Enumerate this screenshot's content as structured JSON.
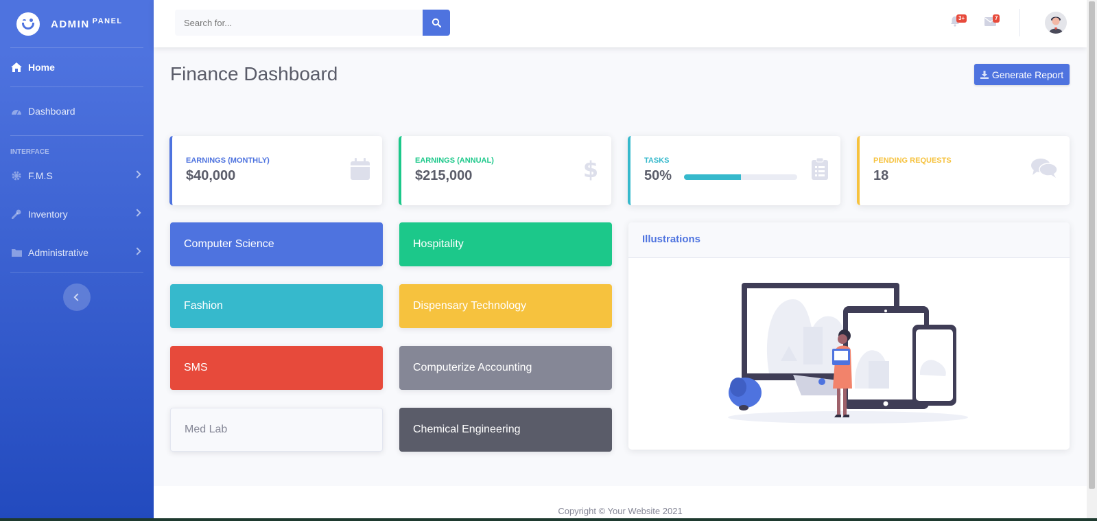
{
  "brand": {
    "name": "ADMIN",
    "suffix": "PANEL"
  },
  "sidebar": {
    "home": "Home",
    "dashboard": "Dashboard",
    "heading": "INTERFACE",
    "items": [
      {
        "label": "F.M.S",
        "icon": "cog-icon"
      },
      {
        "label": "Inventory",
        "icon": "wrench-icon"
      },
      {
        "label": "Administrative",
        "icon": "folder-icon"
      }
    ]
  },
  "topbar": {
    "search_placeholder": "Search for...",
    "alerts_badge": "3+",
    "messages_badge": "7"
  },
  "page": {
    "title": "Finance Dashboard",
    "generate_report": "Generate Report"
  },
  "stats": [
    {
      "label": "Earnings (Monthly)",
      "value": "$40,000",
      "color": "#4e73df",
      "icon": "calendar-icon"
    },
    {
      "label": "Earnings (Annual)",
      "value": "$215,000",
      "color": "#1cc88a",
      "icon": "dollar-icon"
    },
    {
      "label": "Tasks",
      "value": "50%",
      "color": "#36b9cc",
      "icon": "clipboard-icon",
      "progress": 0.5
    },
    {
      "label": "Pending Requests",
      "value": "18",
      "color": "#f6c23e",
      "icon": "comments-icon"
    }
  ],
  "tiles": [
    {
      "label": "Computer Science",
      "color": "#4e73df"
    },
    {
      "label": "Hospitality",
      "color": "#1cc88a"
    },
    {
      "label": "Fashion",
      "color": "#36b9cc"
    },
    {
      "label": "Dispensary Technology",
      "color": "#f6c23e"
    },
    {
      "label": "SMS",
      "color": "#e74a3b"
    },
    {
      "label": "Computerize Accounting",
      "color": "#858796"
    },
    {
      "label": "Med Lab",
      "color": "#f8f9fc"
    },
    {
      "label": "Chemical Engineering",
      "color": "#5a5c69"
    }
  ],
  "illustrations": {
    "title": "Illustrations"
  },
  "footer": {
    "text": "Copyright © Your Website 2021"
  }
}
